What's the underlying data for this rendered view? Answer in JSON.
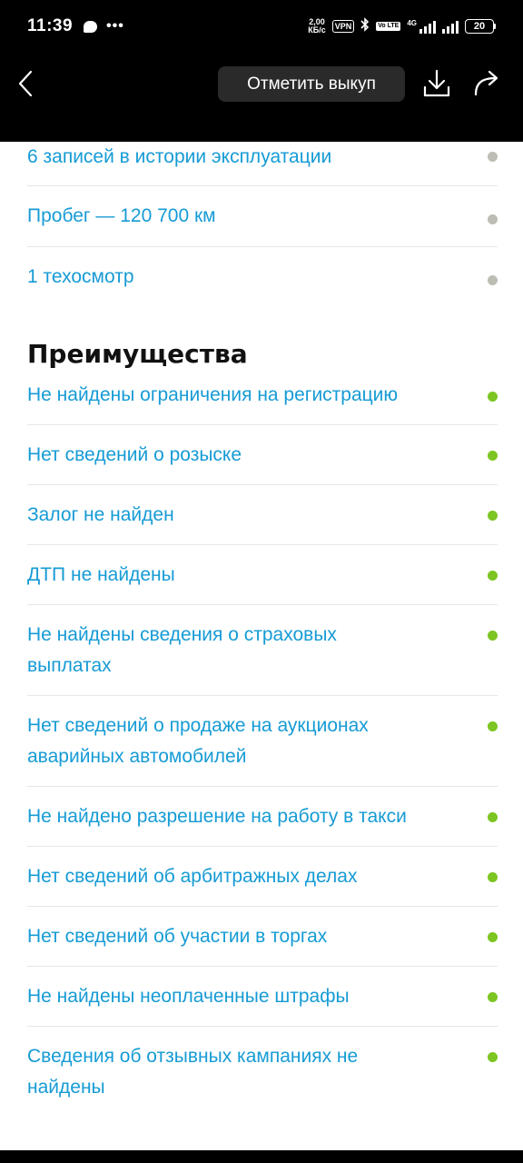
{
  "status_bar": {
    "time": "11:39",
    "net_speed_value": "2,00",
    "net_speed_unit": "КБ/с",
    "vpn": "VPN",
    "volte": "Vo LTE",
    "network_type": "4G",
    "battery": "20"
  },
  "app_bar": {
    "mark_button": "Отметить выкуп"
  },
  "history_items": [
    {
      "text": "6 записей в истории эксплуатации"
    },
    {
      "text": "Пробег — 120 700 км"
    },
    {
      "text": "1 техосмотр"
    }
  ],
  "advantages": {
    "title": "Преимущества",
    "items": [
      {
        "text": "Не найдены ограничения на регистрацию"
      },
      {
        "text": "Нет сведений о розыске"
      },
      {
        "text": "Залог не найден"
      },
      {
        "text": "ДТП не найдены"
      },
      {
        "text": "Не найдены сведения о страховых выплатах"
      },
      {
        "text": "Нет сведений о продаже на аукционах аварийных автомобилей"
      },
      {
        "text": "Не найдено разрешение на работу в такси"
      },
      {
        "text": "Нет сведений об арбитражных делах"
      },
      {
        "text": "Нет сведений об участии в торгах"
      },
      {
        "text": "Не найдены неоплаченные штрафы"
      },
      {
        "text": "Сведения об отзывных кампаниях не найдены"
      }
    ]
  },
  "colors": {
    "link": "#169bd5",
    "dot_neutral": "#bdbdb4",
    "dot_positive": "#7cc522"
  }
}
